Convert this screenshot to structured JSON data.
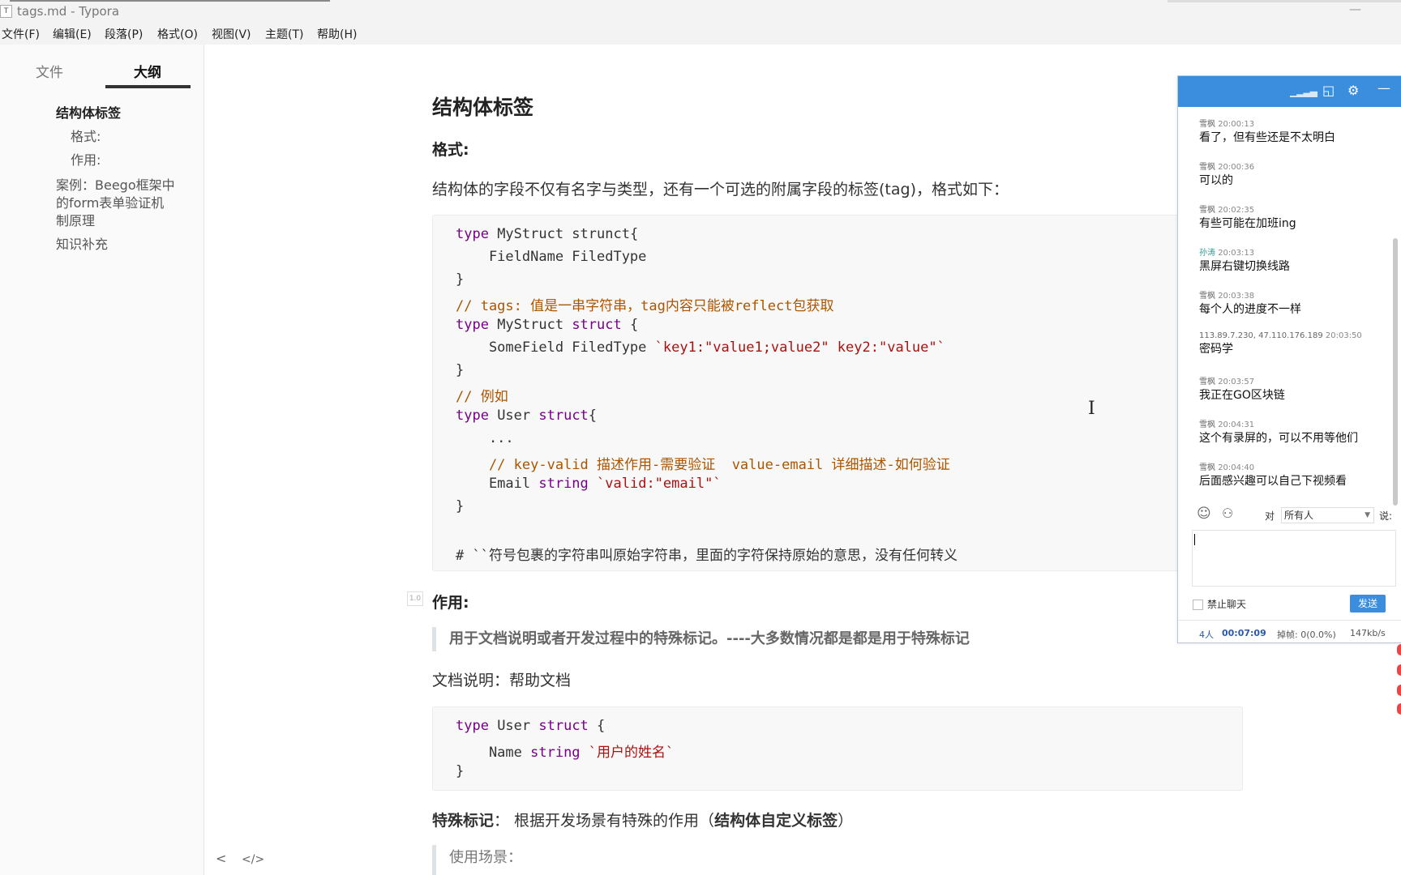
{
  "window": {
    "title": "tags.md - Typora",
    "minimize": "—"
  },
  "menu": [
    "文件(F)",
    "编辑(E)",
    "段落(P)",
    "格式(O)",
    "视图(V)",
    "主题(T)",
    "帮助(H)"
  ],
  "sidebar": {
    "tab_files": "文件",
    "tab_outline": "大纲",
    "outline": [
      "结构体标签",
      "格式:",
      "作用:",
      "案例：Beego框架中",
      "的form表单验证机",
      "制原理",
      "知识补充"
    ],
    "nav_back": "<",
    "nav_source": "</>"
  },
  "doc": {
    "h2": "结构体标签",
    "h3_format": "格式:",
    "p_intro": "结构体的字段不仅有名字与类型，还有一个可选的附属字段的标签(tag)，格式如下：",
    "code1": {
      "l1_kw": "type",
      "l1_rest": " MyStruct strunct{",
      "l2": "    FieldName FiledType",
      "l3": "}",
      "l4": "// tags: 值是一串字符串，tag内容只能被reflect包获取",
      "l5_kw": "type",
      "l5_mid": " MyStruct ",
      "l5_kw2": "struct",
      "l5_end": " {",
      "l6_a": "    SomeField FiledType ",
      "l6_str": "`key1:\"value1;value2\" key2:\"value\"`",
      "l7": "}",
      "l8": "// 例如",
      "l9_kw": "type",
      "l9_mid": " User ",
      "l9_kw2": "struct",
      "l9_end": "{",
      "l10": "    ...",
      "l11": "    // key-valid 描述作用-需要验证  value-email 详细描述-如何验证",
      "l12_a": "    Email ",
      "l12_ty": "string",
      "l12_sp": " ",
      "l12_str": "`valid:\"email\"`",
      "l13": "}",
      "l14": "# ``符号包裹的字符串叫原始字符串，里面的字符保持原始的意思，没有任何转义"
    },
    "h3_use": "作用:",
    "quote1": "用于文档说明或者开发过程中的特殊标记。----大多数情况都是都是用于特殊标记",
    "p_doc": "文档说明：帮助文档",
    "code2": {
      "l1_kw": "type",
      "l1_mid": " User ",
      "l1_kw2": "struct",
      "l1_end": " {",
      "l2_a": "    Name ",
      "l2_ty": "string",
      "l2_sp": " ",
      "l2_str": "`用户的姓名`",
      "l3": "}"
    },
    "p_special_bold": "特殊标记",
    "p_special_mid": "：  根据开发场景有特殊的作用（",
    "p_special_bold2": "结构体自定义标签",
    "p_special_end": "）",
    "quote2": "使用场景：",
    "para_icon": "1.0"
  },
  "chat": {
    "messages": [
      {
        "name": "雪枫",
        "time": "20:00:13",
        "text": "看了，但有些还是不太明白"
      },
      {
        "name": "雪枫",
        "time": "20:00:36",
        "text": "可以的"
      },
      {
        "name": "雪枫",
        "time": "20:02:35",
        "text": "有些可能在加班ing"
      },
      {
        "name": "孙涛",
        "time": "20:03:13",
        "text": "黑屏右键切换线路"
      },
      {
        "name": "雪枫",
        "time": "20:03:38",
        "text": "每个人的进度不一样"
      },
      {
        "name": "113.89.7.230,  47.110.176.189",
        "time": "20:03:50",
        "text": "密码学"
      },
      {
        "name": "雪枫",
        "time": "20:03:57",
        "text": "我正在GO区块链"
      },
      {
        "name": "雪枫",
        "time": "20:04:31",
        "text": "这个有录屏的，可以不用等他们"
      },
      {
        "name": "雪枫",
        "time": "20:04:40",
        "text": "后面感兴趣可以自己下视频看"
      }
    ],
    "to_label": "对",
    "to_value": "所有人",
    "say_label": "说:",
    "ban_label": "禁止聊天",
    "send_label": "发送",
    "status": {
      "people": "4人",
      "time": "00:07:09",
      "drop": "掉帧: 0(0.0%)",
      "rate": "147kb/s"
    }
  }
}
